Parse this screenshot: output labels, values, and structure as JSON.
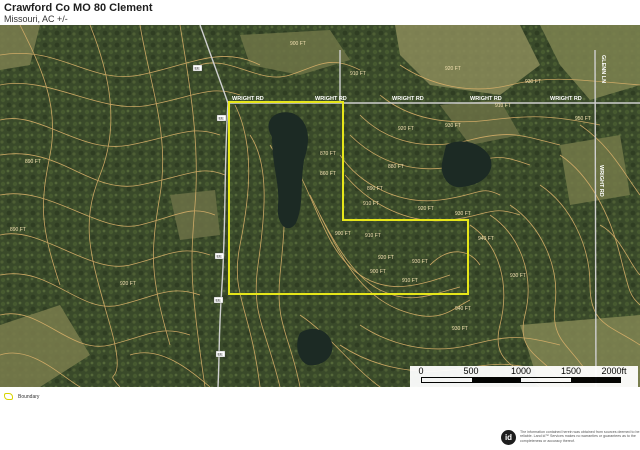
{
  "header": {
    "title": "Crawford Co MO 80 Clement",
    "subtitle": "Missouri,  AC +/-"
  },
  "map": {
    "road_labels": [
      "WRIGHT RD",
      "WRIGHT RD",
      "WRIGHT RD",
      "WRIGHT RD",
      "WRIGHT RD",
      "GLENN LN",
      "WRIGHT RD"
    ],
    "contour_labels": [
      "900 FT",
      "910 FT",
      "920 FT",
      "930 FT",
      "930 FT",
      "950 FT",
      "910 FT",
      "920 FT",
      "870 FT",
      "860 FT",
      "880 FT",
      "890 FT",
      "890 FT",
      "910 FT",
      "930 FT",
      "920 FT",
      "900 FT",
      "910 FT",
      "920 FT",
      "930 FT",
      "940 FT",
      "900 FT",
      "940 FT",
      "930 FT",
      "890 FT",
      "910 FT",
      "930 FT",
      "920 FT"
    ],
    "route_badges": [
      "EE",
      "EE",
      "EE",
      "EE",
      "EE"
    ],
    "colors": {
      "boundary": "#e6e61a",
      "contour": "#d9b06a",
      "road": "#cfcfcf",
      "water": "#1c2a24"
    }
  },
  "scalebar": {
    "ticks": [
      "0",
      "500",
      "1000",
      "1500",
      "2000ft"
    ]
  },
  "legend": {
    "boundary_label": "Boundary"
  },
  "footer": {
    "logo": "id",
    "disclaimer": "The information contained herein was obtained from sources deemed to be reliable. Land id™ Services makes no warranties or guarantees as to the completeness or accuracy thereof."
  }
}
